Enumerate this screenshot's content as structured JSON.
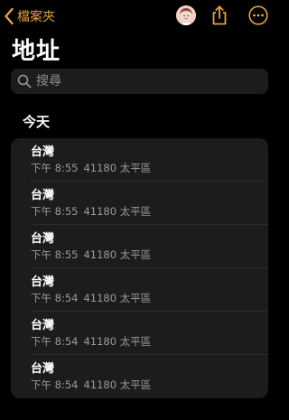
{
  "nav": {
    "back_label": "檔案夾"
  },
  "page": {
    "title": "地址"
  },
  "search": {
    "placeholder": "搜尋",
    "value": ""
  },
  "section": {
    "label": "今天"
  },
  "notes": [
    {
      "title": "台灣",
      "time": "下午 8:55",
      "preview": "41180 太平區"
    },
    {
      "title": "台灣",
      "time": "下午 8:55",
      "preview": "41180 太平區"
    },
    {
      "title": "台灣",
      "time": "下午 8:55",
      "preview": "41180 太平區"
    },
    {
      "title": "台灣",
      "time": "下午 8:54",
      "preview": "41180 太平區"
    },
    {
      "title": "台灣",
      "time": "下午 8:54",
      "preview": "41180 太平區"
    },
    {
      "title": "台灣",
      "time": "下午 8:54",
      "preview": "41180 太平區"
    }
  ],
  "colors": {
    "accent": "#e8a33c",
    "background": "#000000",
    "card": "#1c1c1e",
    "secondary_text": "#9a9a9f"
  },
  "icons": [
    "chevron-left-icon",
    "avatar",
    "share-icon",
    "more-icon",
    "search-icon"
  ]
}
